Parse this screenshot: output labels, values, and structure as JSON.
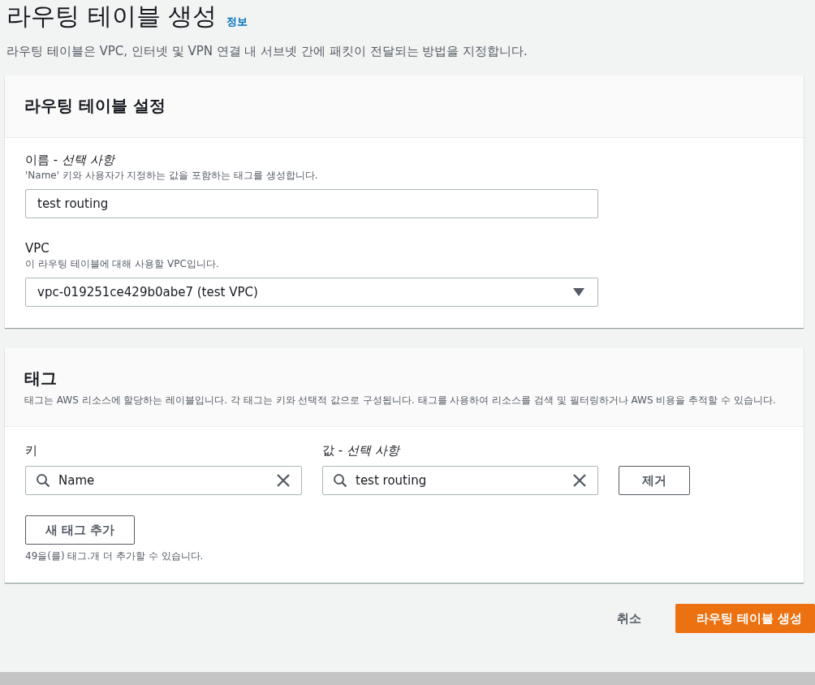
{
  "header": {
    "title": "라우팅 테이블 생성",
    "info_link": "정보",
    "description": "라우팅 테이블은 VPC, 인터넷 및 VPN 연결 내 서브넷 간에 패킷이 전달되는 방법을 지정합니다."
  },
  "settings": {
    "title": "라우팅 테이블 설정",
    "name_field": {
      "label": "이름 - *선택 사항*",
      "hint": "'Name' 키와 사용자가 지정하는 값을 포함하는 태그를 생성합니다.",
      "value": "test routing"
    },
    "vpc_field": {
      "label": "VPC",
      "hint": "이 라우팅 테이블에 대해 사용할 VPC입니다.",
      "value": "vpc-019251ce429b0abe7 (test VPC)"
    }
  },
  "tags": {
    "title": "태그",
    "description": "태그는 AWS 리소스에 할당하는 레이블입니다. 각 태그는 키와 선택적 값으로 구성됩니다. 태그를 사용하여 리소스를 검색 및 필터링하거나 AWS 비용을 추적할 수 있습니다.",
    "key_label": "키",
    "value_label": "값 - *선택 사항*",
    "rows": [
      {
        "key": "Name",
        "value": "test routing",
        "remove_button": "제거"
      }
    ],
    "add_button": "새 태그 추가",
    "limit_note": "49을(를) 태그.개 더 추가할 수 있습니다."
  },
  "footer": {
    "cancel": "취소",
    "submit": "라우팅 테이블 생성"
  }
}
